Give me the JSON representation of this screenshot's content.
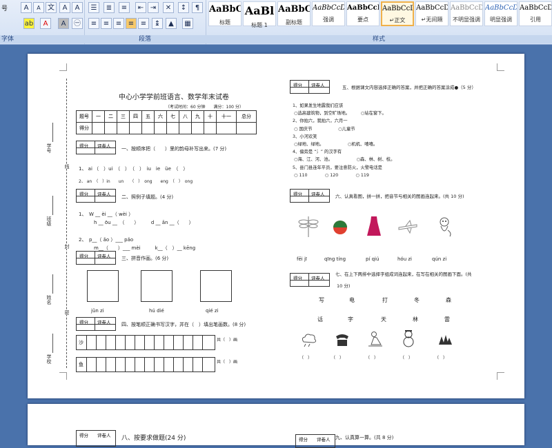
{
  "ribbon": {
    "font_group_label": "字体",
    "paragraph_group_label": "段落",
    "styles_group_label": "样式",
    "font_size_partial": "号",
    "styles": [
      {
        "sample": "AaBbC",
        "name": "标题"
      },
      {
        "sample": "AaBl",
        "name": "标题 1"
      },
      {
        "sample": "AaBbC",
        "name": "副标题"
      },
      {
        "sample": "AaBbCcDd",
        "name": "强调"
      },
      {
        "sample": "AaBbCcD",
        "name": "要点"
      },
      {
        "sample": "AaBbCcDd",
        "name": "↵正文"
      },
      {
        "sample": "AaBbCcDd",
        "name": "↵无间隔"
      },
      {
        "sample": "AaBbCcDd",
        "name": "不明显强调"
      },
      {
        "sample": "AaBbCcDd",
        "name": "明显强调"
      },
      {
        "sample": "AaBbCcDd",
        "name": "引用"
      }
    ]
  },
  "doc": {
    "title": "中心小学学前班语言、数学年末试卷",
    "subtitle": "（考试时间：60 分钟　　满分：100 分）",
    "score_header": [
      "题号",
      "一",
      "二",
      "三",
      "四",
      "五",
      "六",
      "七",
      "八",
      "九",
      "十",
      "十一",
      "总分"
    ],
    "score_row_label": "得分",
    "score_label": "得分",
    "grader_label": "评卷人",
    "binding_labels": [
      "学号",
      "班级",
      "姓名",
      "学校"
    ],
    "binding_marks": [
      "线",
      "封",
      "密"
    ],
    "q1": "一、按顺序把（　　）里的韵母补写出来。(7 分)",
    "q1_line1": "1、 ai （　）ui　（　）　（　）　iu　ie　üe　（　）",
    "q1_line2": "2、 an　（　）in　　un　　（　）　ong　　eng　（　）　ong",
    "q2": "二、照例子填题。(4 分)",
    "q2_line1": "1、　W __ èi __（ wèi ）",
    "q2_line2": "h __ ōu __　（　　）　　　d __ ǎn __（　　）",
    "q2_line3": "2、　p__（ ǎo ）___ pǎo",
    "q2_line4": "m__（　　）___ mèi　　　k__（　）__ kēng",
    "q3": "三、拼音作画。(6 分)",
    "q3_words": [
      "jǔn zi",
      "hú dié",
      "qié zi"
    ],
    "q4": "四、按笔顺正确书写汉字，并在（　）填出笔画数。(8 分)",
    "q4_chars": [
      "沙",
      "鱼"
    ],
    "q4_suffix": "共（　）画",
    "q5": "五、根据课文内容选择正确的答案，并把正确的答案涂成●（5 分）",
    "q5_items": [
      "1、如果发生地震我们应该",
      "○选高建筑物，到空旷场地。　　　○站在窗下。",
      "2、你拍六，我拍六，六月一",
      "○ 国庆节　　　　　　○儿童节",
      "3、小河欢笑",
      "○绿地、绿地。　　　　　　○机机、嘻嘻。",
      "4、偏旁是 “氵” 的汉字有",
      "○海、江、河、池。　　　　　　○森、林、树、枝。",
      "5、县门县连年平员，要注意防火，火警电话是",
      "○ 110　　　　○ 120　　　　○ 119"
    ],
    "q6": "六、认真看图，拼一拼，把音节与相关的图画连起来。(共 10 分)",
    "q6_pinyin": [
      "fēi jī",
      "qīng tíng",
      "pí qiú",
      "hóu zi",
      "qún zi"
    ],
    "q7": "七、在上下两排中选择字组成词连起来，在写在相关的图画下面。(共",
    "q7_points": "10 分)",
    "q7_row1": [
      "写",
      "电",
      "打",
      "冬",
      "森"
    ],
    "q7_row2": [
      "话",
      "字",
      "天",
      "林",
      "雷"
    ],
    "q7_blanks": [
      "（　）",
      "（　）",
      "（　）",
      "（　）",
      "（　）"
    ],
    "page2_q8": "八、按要求做题(24 分)",
    "page2_q9": "九、认真算一算。(共 8 分)"
  }
}
